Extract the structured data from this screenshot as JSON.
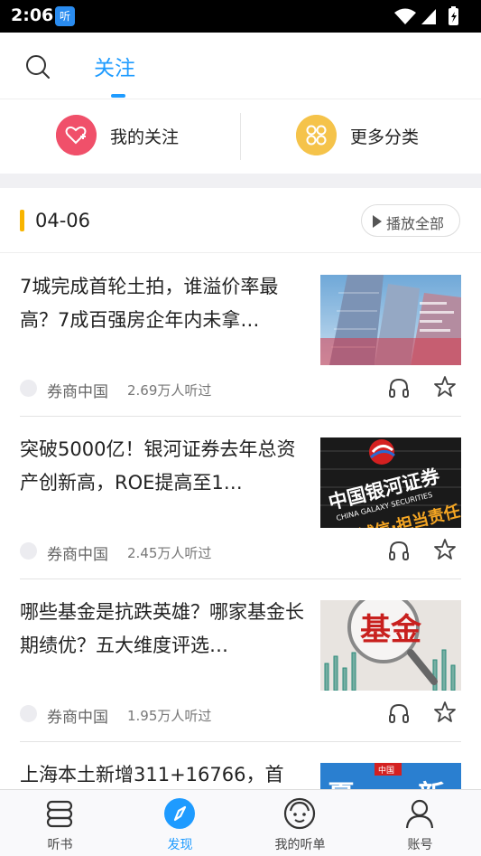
{
  "status_bar": {
    "time": "2:06",
    "app_badge": "听"
  },
  "header": {
    "active_tab": "关注",
    "search_icon": "search-icon"
  },
  "quick_links": [
    {
      "label": "我的关注",
      "icon": "heart-plus-icon",
      "color": "#f0506a"
    },
    {
      "label": "更多分类",
      "icon": "category-grid-icon",
      "color": "#f5c34a"
    }
  ],
  "section": {
    "date": "04-06",
    "play_all_label": "播放全部"
  },
  "articles": [
    {
      "title": "7城完成首轮土拍，谁溢价率最高？7成百强房企年内未拿…",
      "source": "券商中国",
      "plays": "2.69万人听过",
      "thumb": "city-buildings-thumbnail"
    },
    {
      "title": "突破5000亿！银河证券去年总资产创新高，ROE提高至1…",
      "source": "券商中国",
      "plays": "2.45万人听过",
      "thumb": "galaxy-securities-thumbnail"
    },
    {
      "title": "哪些基金是抗跌英雄？哪家基金长期绩优？五大维度评选…",
      "source": "券商中国",
      "plays": "1.95万人听过",
      "thumb": "fund-magnifier-thumbnail"
    },
    {
      "title": "上海本土新增311+16766，首",
      "source": "",
      "plays": "",
      "thumb": "news-thumbnail"
    }
  ],
  "thumb_texts": {
    "galaxy_cn": "中国银河证券",
    "galaxy_en": "CHINA GALAXY SECURITIES",
    "galaxy_slogan": "诚信·担当责任",
    "fund": "基金",
    "news_badge": "中国",
    "news_a": "夏",
    "news_b": "新"
  },
  "bottom_nav": [
    {
      "label": "听书",
      "icon": "bookshelf-icon",
      "active": false
    },
    {
      "label": "发现",
      "icon": "compass-icon",
      "active": true
    },
    {
      "label": "我的听单",
      "icon": "face-icon",
      "active": false
    },
    {
      "label": "账号",
      "icon": "user-icon",
      "active": false
    }
  ],
  "colors": {
    "accent": "#1e9bff",
    "date_marker": "#f8b500",
    "follow_icon": "#f0506a",
    "more_icon": "#f5c34a"
  }
}
